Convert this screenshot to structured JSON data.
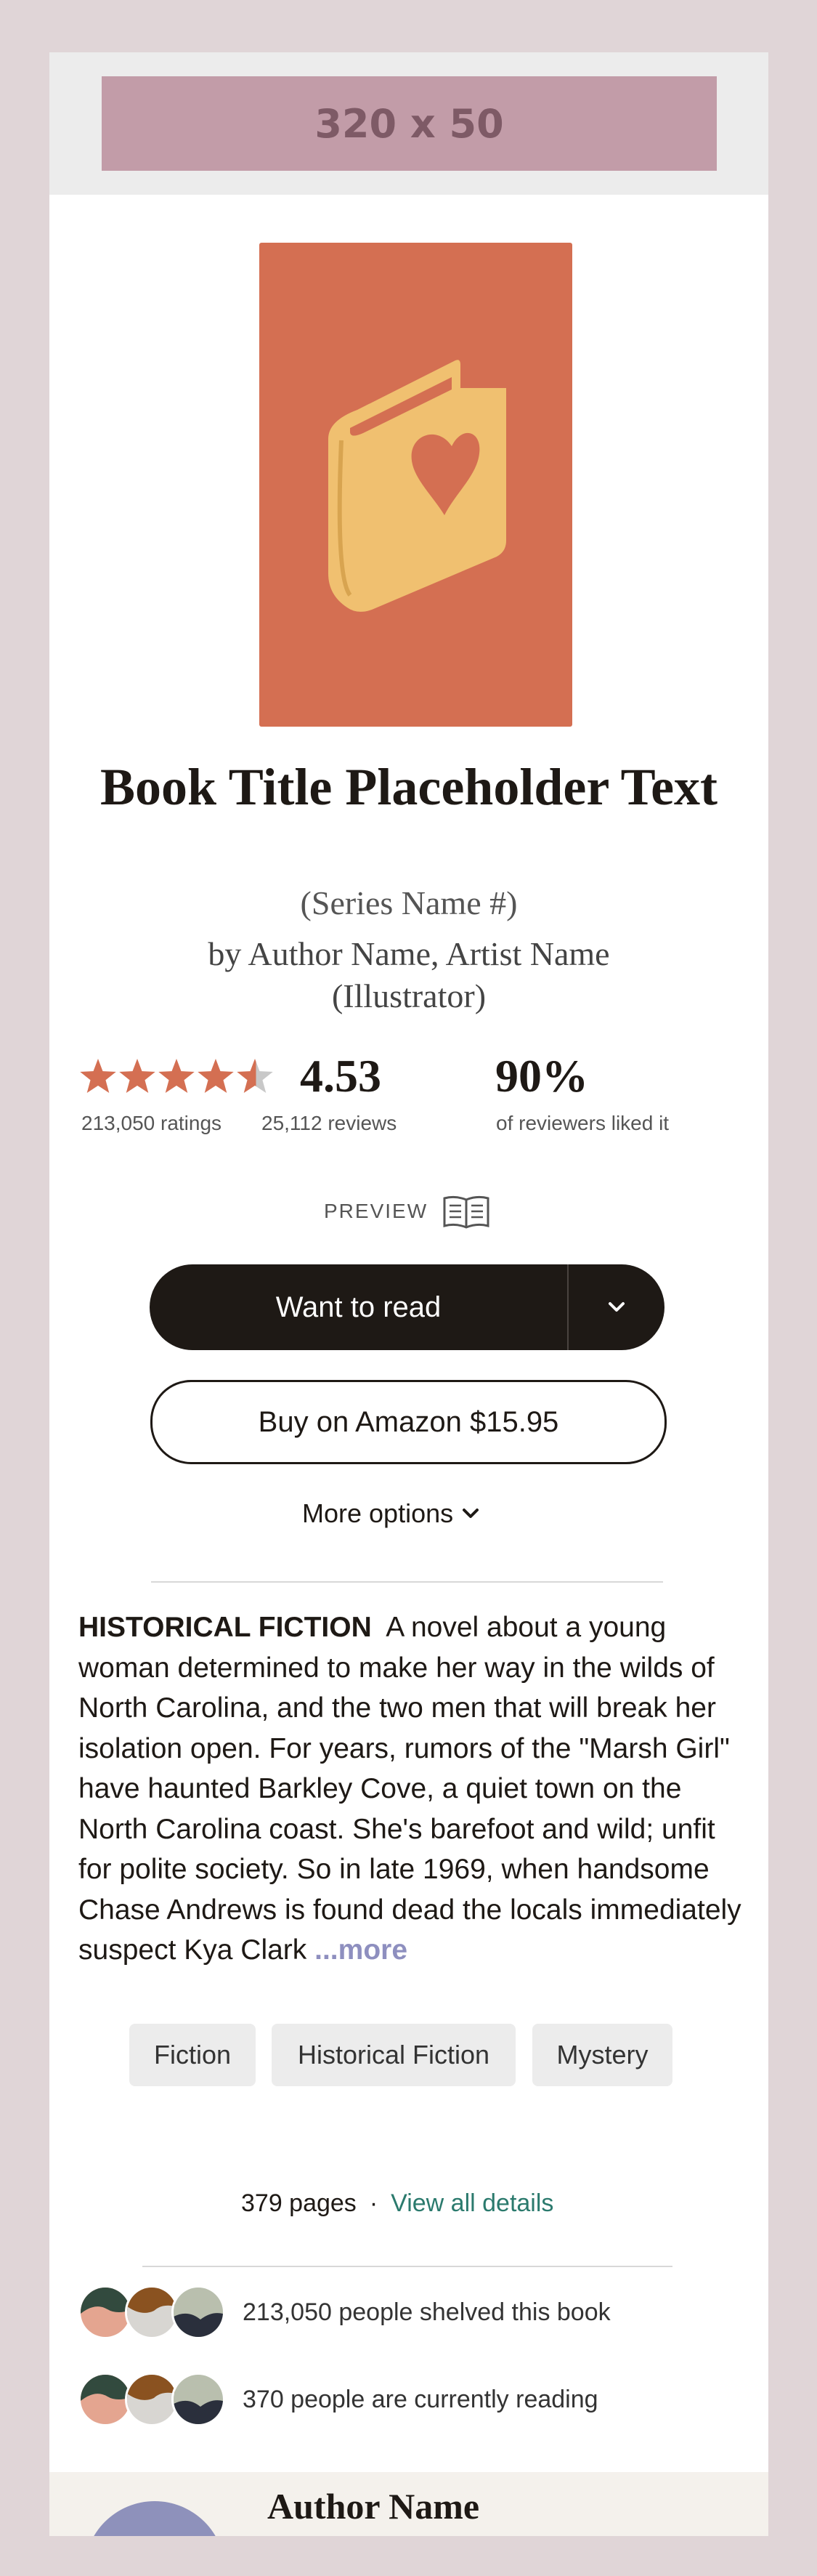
{
  "ad": {
    "label": "320 x 50"
  },
  "book": {
    "title": "Book Title Placeholder Text",
    "series": "(Series Name #)",
    "authors": "by Author Name, Artist Name (Illustrator)"
  },
  "rating": {
    "stars": 4.53,
    "value": "4.53",
    "ratings_count": "213,050 ratings",
    "reviews_count": "25,112 reviews",
    "liked_percent": "90%",
    "liked_label": "of reviewers liked it"
  },
  "preview": {
    "label": "PREVIEW"
  },
  "actions": {
    "want_to_read": "Want to read",
    "buy": "Buy on Amazon $15.95",
    "more_options": "More options"
  },
  "description": {
    "genre": "HISTORICAL FICTION",
    "text": "A novel about a young woman determined to make her way in the wilds of North Carolina, and the two men that will break her isolation open. For years, rumors of the \"Marsh Girl\" have haunted Barkley Cove, a quiet town on the North Carolina coast. She's barefoot and wild; unfit for polite society. So in late 1969, when handsome Chase Andrews is found dead the locals immediately suspect Kya Clark",
    "more": "...more"
  },
  "tags": [
    "Fiction",
    "Historical Fiction",
    "Mystery"
  ],
  "details": {
    "pages": "379 pages",
    "separator": "·",
    "link": "View all details"
  },
  "social": {
    "shelved": "213,050 people shelved this book",
    "reading": "370 people are currently reading"
  },
  "author_section": {
    "name": "Author Name"
  },
  "colors": {
    "page_bg": "#e0d5d7",
    "cover": "#d46f52",
    "book_icon": "#f0c070",
    "star": "#d46f52",
    "button_dark": "#1e1915",
    "link": "#2b7a6d",
    "more_link": "#8e8fbf"
  }
}
